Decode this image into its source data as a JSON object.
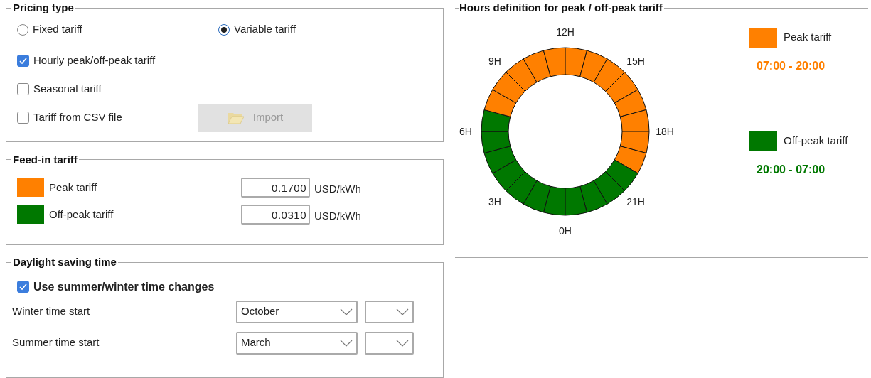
{
  "pricing_type": {
    "title": "Pricing type",
    "radios": [
      {
        "label": "Fixed tariff",
        "selected": false
      },
      {
        "label": "Variable tariff",
        "selected": true
      }
    ],
    "checkboxes": [
      {
        "label": "Hourly peak/off-peak tariff",
        "checked": true
      },
      {
        "label": "Seasonal tariff",
        "checked": false
      },
      {
        "label": "Tariff from CSV file",
        "checked": false
      }
    ],
    "import_button": {
      "label": "Import",
      "disabled": true
    }
  },
  "feed_in_tariff": {
    "title": "Feed-in tariff",
    "rows": [
      {
        "label": "Peak tariff",
        "color": "#ff8000",
        "value": "0.1700",
        "unit": "USD/kWh"
      },
      {
        "label": "Off-peak tariff",
        "color": "#007800",
        "value": "0.0310",
        "unit": "USD/kWh"
      }
    ]
  },
  "daylight_saving_time": {
    "title": "Daylight saving time",
    "checkbox": {
      "label": "Use summer/winter time changes",
      "checked": true
    },
    "rows": [
      {
        "label": "Winter time start",
        "month": "October"
      },
      {
        "label": "Summer time start",
        "month": "March"
      }
    ]
  },
  "hours_definition": {
    "title": "Hours definition for peak / off-peak tariff",
    "hour_labels": [
      "0H",
      "3H",
      "6H",
      "9H",
      "12H",
      "15H",
      "18H",
      "21H"
    ],
    "segments": [
      {
        "peak": false
      },
      {
        "peak": false
      },
      {
        "peak": false
      },
      {
        "peak": false
      },
      {
        "peak": false
      },
      {
        "peak": false
      },
      {
        "peak": false
      },
      {
        "peak": true
      },
      {
        "peak": true
      },
      {
        "peak": true
      },
      {
        "peak": true
      },
      {
        "peak": true
      },
      {
        "peak": true
      },
      {
        "peak": true
      },
      {
        "peak": true
      },
      {
        "peak": true
      },
      {
        "peak": true
      },
      {
        "peak": true
      },
      {
        "peak": true
      },
      {
        "peak": true
      },
      {
        "peak": false
      },
      {
        "peak": false
      },
      {
        "peak": false
      },
      {
        "peak": false
      }
    ],
    "legend": [
      {
        "label": "Peak tariff",
        "color": "#ff8000",
        "range": "07:00 - 20:00"
      },
      {
        "label": "Off-peak tariff",
        "color": "#007800",
        "range": "20:00 - 07:00"
      }
    ]
  }
}
